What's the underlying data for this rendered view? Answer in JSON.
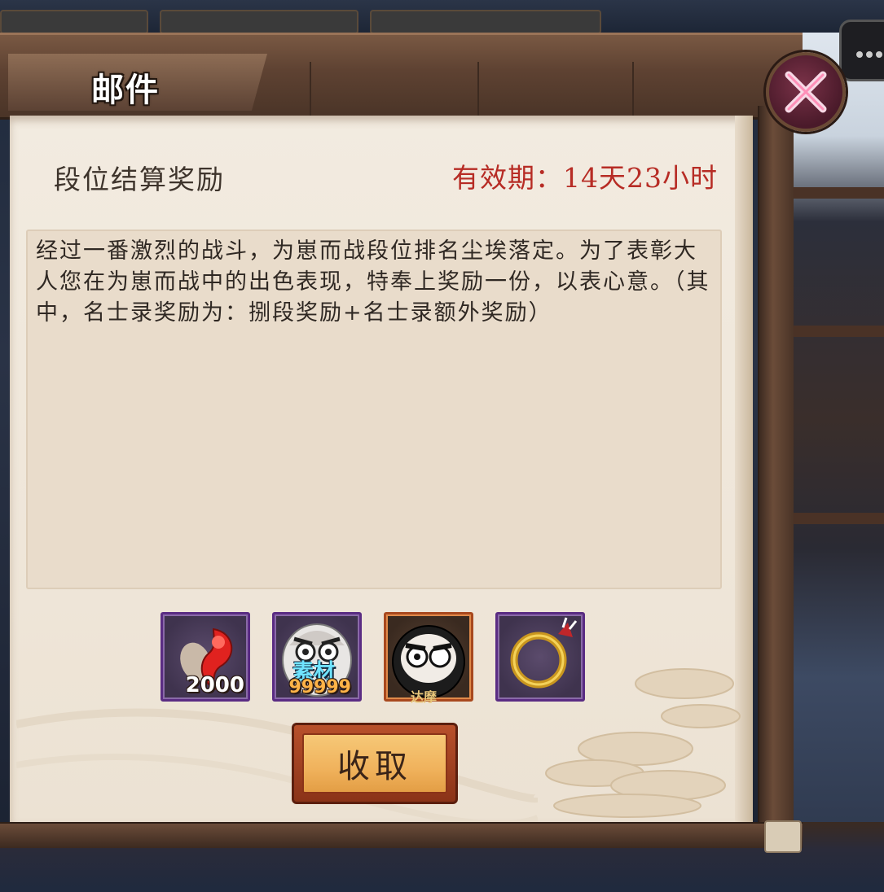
{
  "window": {
    "title": "邮件"
  },
  "mail": {
    "subject": "段位结算奖励",
    "expiry": "有效期：14天23小时",
    "body": "经过一番激烈的战斗，为崽而战段位排名尘埃落定。为了表彰大人您在为崽而战中的出色表现，特奉上奖励一份，以表心意。（其中，名士录奖励为：捌段奖励+名士录额外奖励）"
  },
  "rewards": [
    {
      "icon": "red-magatama-icon",
      "count": "2000"
    },
    {
      "icon": "material-daruma-icon",
      "tag": "素材",
      "count": "99999"
    },
    {
      "icon": "black-daruma-icon",
      "tag": "达摩"
    },
    {
      "icon": "golden-ring-icon"
    }
  ],
  "buttons": {
    "claim_label": "收取"
  },
  "colors": {
    "expiry_red": "#b72c25",
    "paper": "#efe6d9",
    "frame_wood": "#5e4232",
    "button_orange": "#f0b25c"
  }
}
